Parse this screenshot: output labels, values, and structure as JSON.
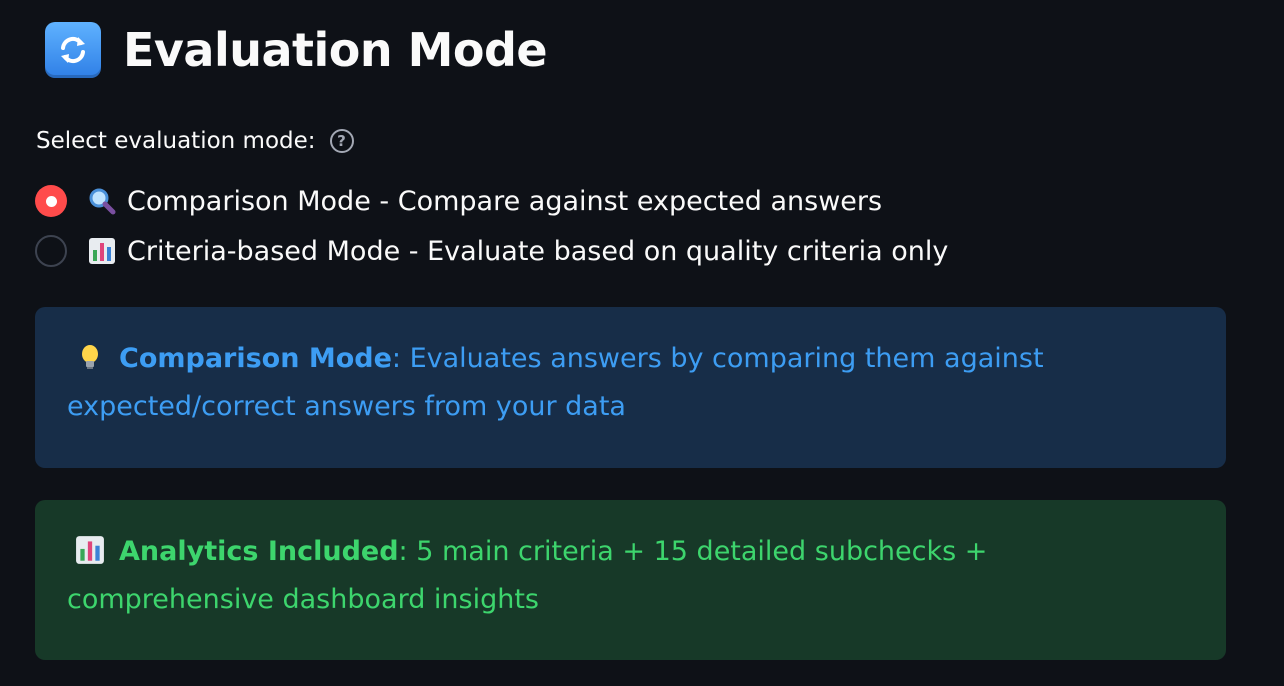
{
  "header": {
    "title": "Evaluation Mode",
    "title_icon": "refresh-arrows-icon"
  },
  "radio_group": {
    "label": "Select evaluation mode:",
    "help_icon": "question-circle-icon",
    "options": [
      {
        "icon": "magnifying-glass-icon",
        "label": "Comparison Mode - Compare against expected answers",
        "selected": true
      },
      {
        "icon": "bar-chart-icon",
        "label": "Criteria-based Mode - Evaluate based on quality criteria only",
        "selected": false
      }
    ]
  },
  "info_box": {
    "icon": "light-bulb-icon",
    "bold": "Comparison Mode",
    "text": ": Evaluates answers by comparing them against expected/correct answers from your data"
  },
  "success_box": {
    "icon": "bar-chart-icon",
    "bold": "Analytics Included",
    "text": ": 5 main criteria + 15 detailed subchecks + comprehensive dashboard insights"
  },
  "colors": {
    "background": "#0e1117",
    "accent_red": "#ff4b4b",
    "info_bg": "#172d48",
    "info_text": "#3d9df3",
    "success_bg": "#173928",
    "success_text": "#3dd56d"
  }
}
